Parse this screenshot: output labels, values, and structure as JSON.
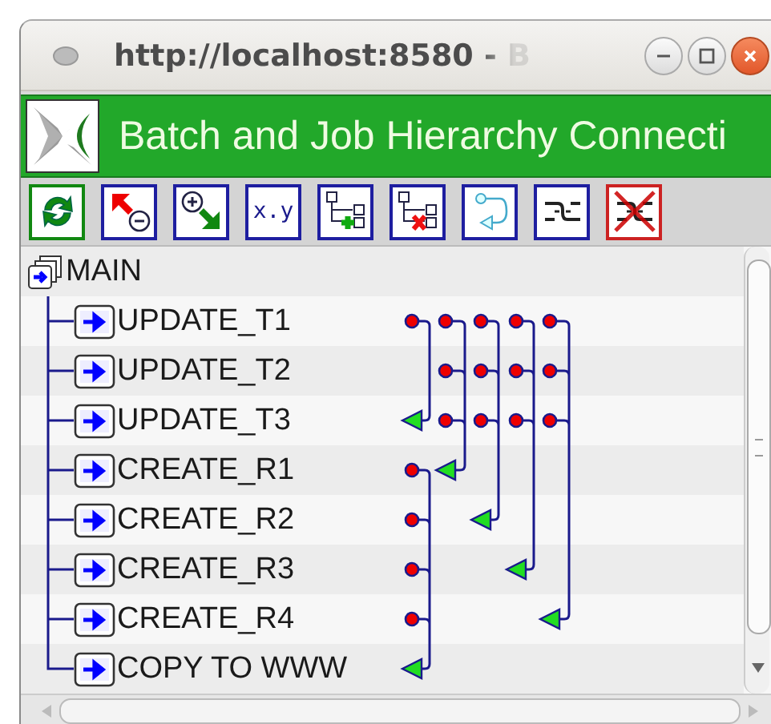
{
  "window": {
    "title": "http://localhost:8580 - B"
  },
  "header": {
    "title": "Batch and Job Hierarchy Connecti"
  },
  "toolbar": [
    {
      "kind": "refresh"
    },
    {
      "kind": "up-minus"
    },
    {
      "kind": "plus-down"
    },
    {
      "kind": "text",
      "label": "x.y"
    },
    {
      "kind": "add-node"
    },
    {
      "kind": "delete-node"
    },
    {
      "kind": "loop"
    },
    {
      "kind": "link"
    },
    {
      "kind": "delete-link"
    }
  ],
  "tree": {
    "label": "MAIN",
    "children": [
      {
        "label": "UPDATE_T1"
      },
      {
        "label": "UPDATE_T2"
      },
      {
        "label": "UPDATE_T3"
      },
      {
        "label": "CREATE_R1"
      },
      {
        "label": "CREATE_R2"
      },
      {
        "label": "CREATE_R3"
      },
      {
        "label": "CREATE_R4"
      },
      {
        "label": "COPY TO WWW"
      }
    ]
  }
}
